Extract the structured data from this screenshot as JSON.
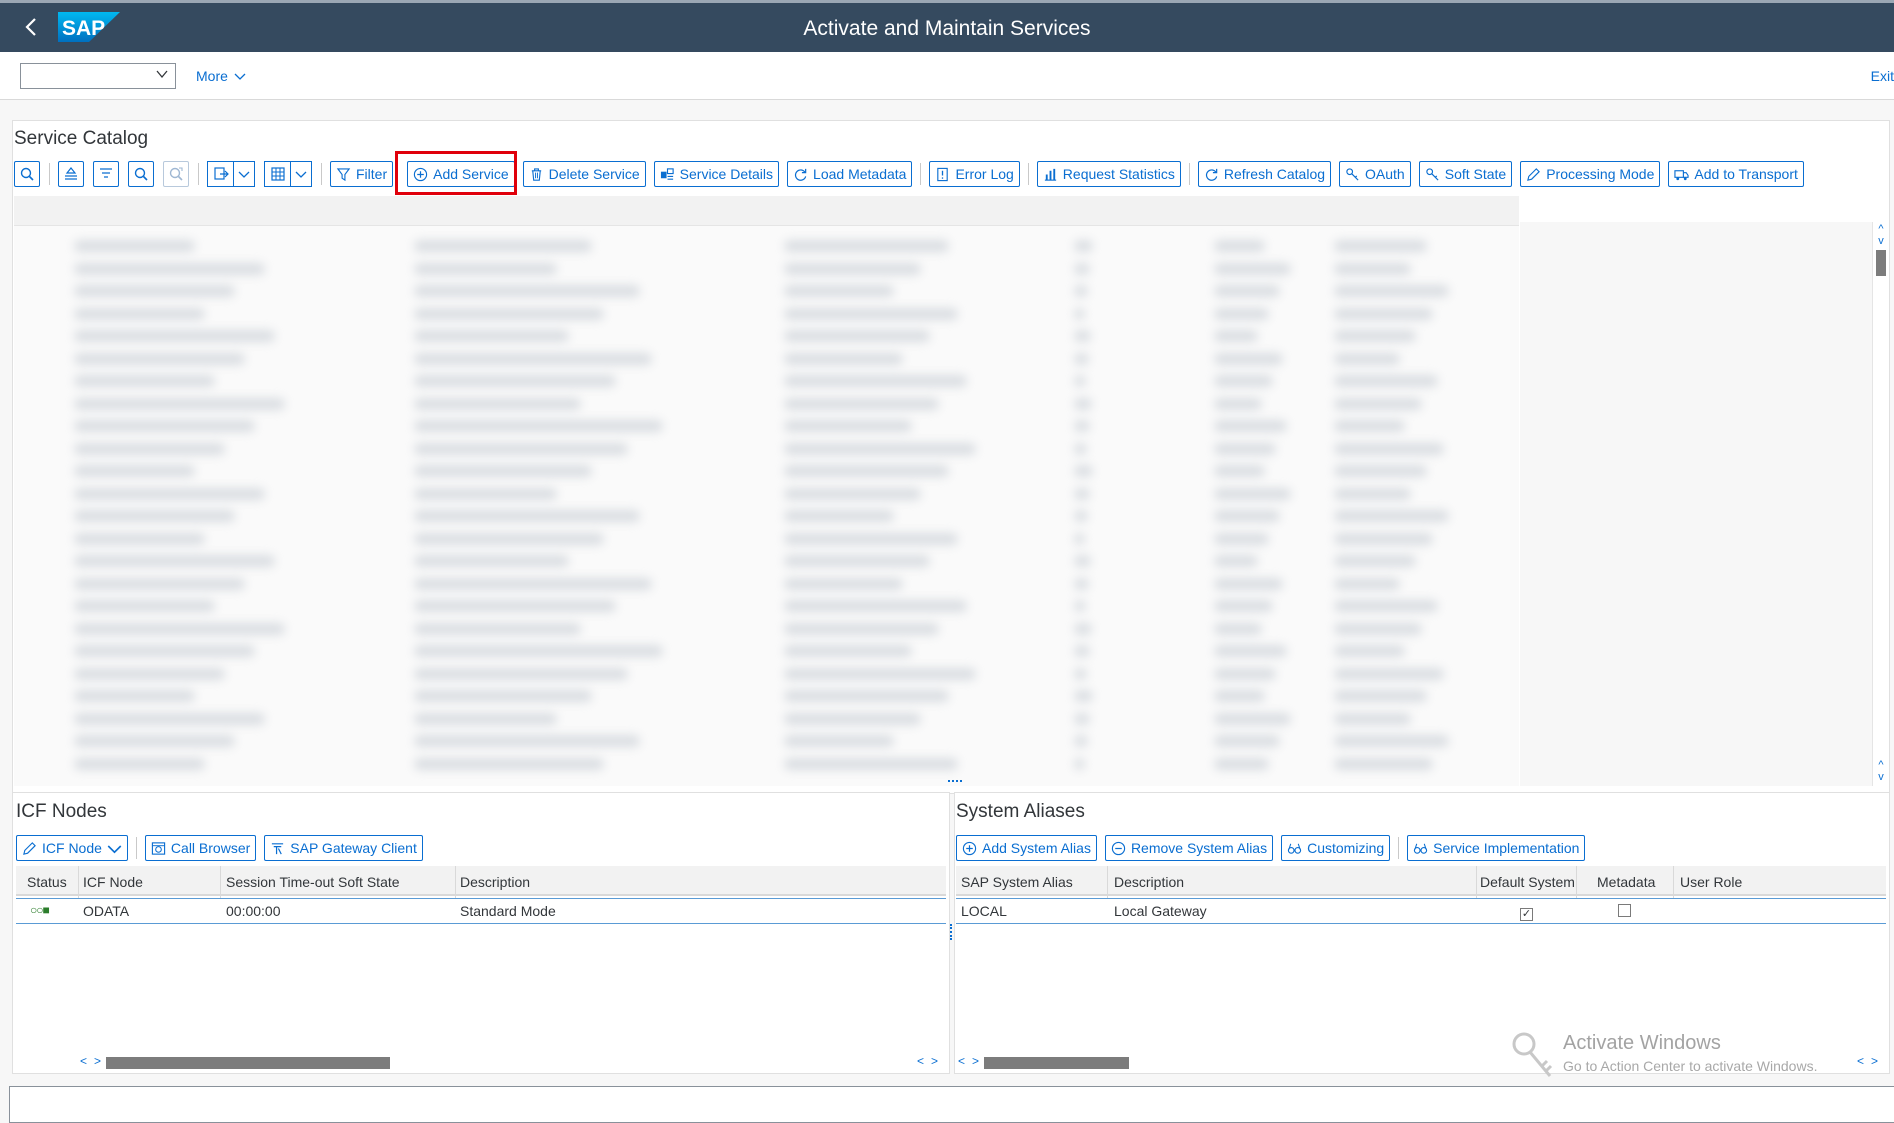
{
  "shell": {
    "title": "Activate and Maintain Services",
    "logo_text": "SAP"
  },
  "toolbar": {
    "command_field_value": "",
    "more_label": "More",
    "exit_label": "Exit"
  },
  "service_catalog": {
    "title": "Service Catalog",
    "buttons": {
      "filter": "Filter",
      "add_service": "Add Service",
      "delete_service": "Delete Service",
      "service_details": "Service Details",
      "load_metadata": "Load Metadata",
      "error_log": "Error Log",
      "request_statistics": "Request Statistics",
      "refresh_catalog": "Refresh Catalog",
      "oauth": "OAuth",
      "soft_state": "Soft State",
      "processing_mode": "Processing Mode",
      "add_to_transport": "Add to Transport"
    }
  },
  "icf_nodes": {
    "title": "ICF Nodes",
    "buttons": {
      "icf_node": "ICF Node",
      "call_browser": "Call Browser",
      "sap_gateway_client": "SAP Gateway Client"
    },
    "columns": [
      "Status",
      "ICF Node",
      "Session Time-out Soft State",
      "Description"
    ],
    "rows": [
      {
        "status": "○○■",
        "icf_node": "ODATA",
        "timeout": "00:00:00",
        "description": "Standard Mode"
      }
    ]
  },
  "system_aliases": {
    "title": "System Aliases",
    "buttons": {
      "add_system_alias": "Add System Alias",
      "remove_system_alias": "Remove System Alias",
      "customizing": "Customizing",
      "service_implementation": "Service Implementation"
    },
    "columns": [
      "SAP System Alias",
      "Description",
      "Default System",
      "Metadata",
      "User Role"
    ],
    "rows": [
      {
        "alias": "LOCAL",
        "description": "Local Gateway",
        "default_system": true,
        "metadata": false,
        "user_role": ""
      }
    ]
  },
  "watermark": {
    "title": "Activate Windows",
    "subtitle": "Go to Action Center to activate Windows."
  },
  "colors": {
    "shell": "#354a5f",
    "accent": "#0a6ed1",
    "highlight": "#e0000b"
  }
}
